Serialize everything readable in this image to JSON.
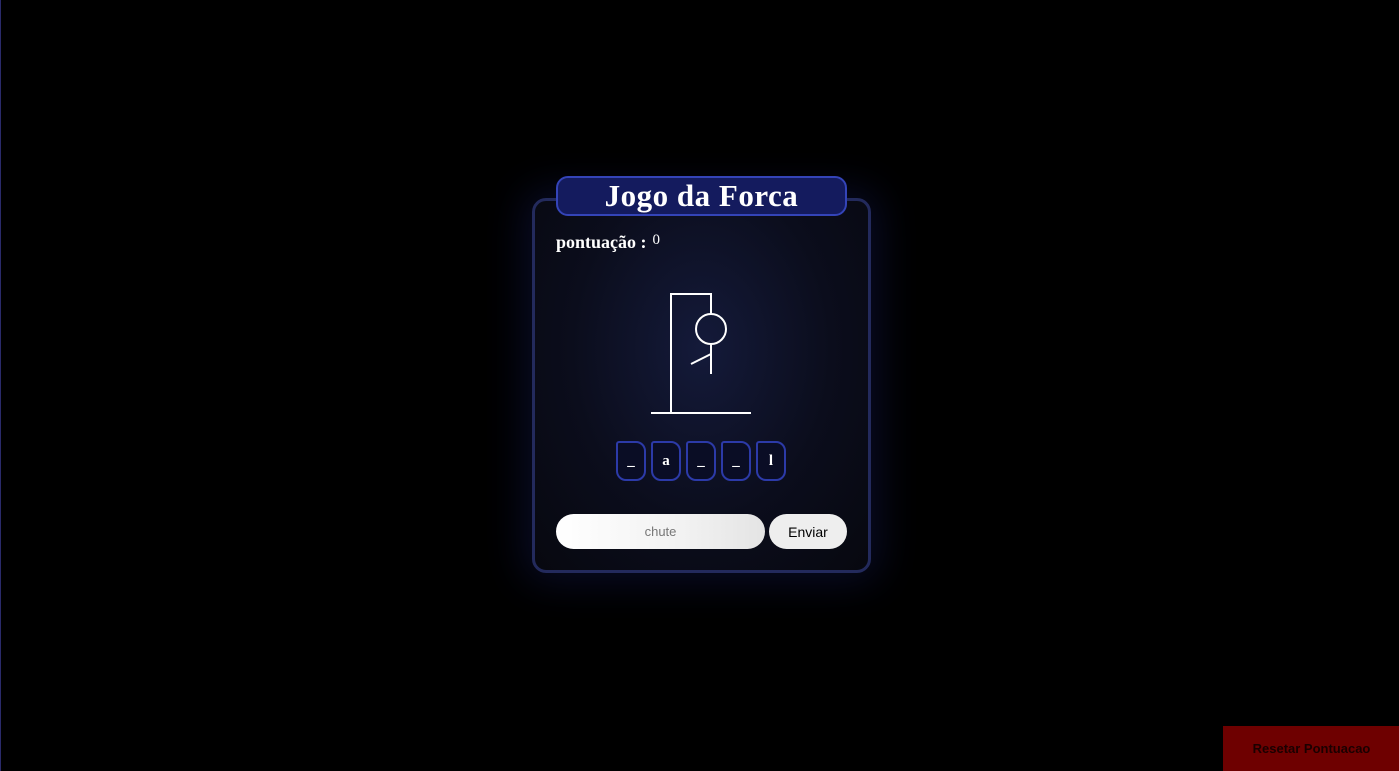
{
  "game": {
    "title": "Jogo da Forca",
    "score_label": "pontuação :",
    "score_value": "0",
    "word_slots": [
      "_",
      "a",
      "_",
      "_",
      "l"
    ],
    "guess_placeholder": "chute",
    "send_label": "Enviar",
    "reset_label": "Resetar Pontuacao",
    "hangman_parts_shown": [
      "head",
      "body",
      "left-arm"
    ]
  },
  "colors": {
    "background": "#000000",
    "card_border": "#232a5c",
    "title_bg": "#141b5e",
    "title_border": "#3444b8",
    "letter_border": "#2c3aa8",
    "reset_bg": "#6e0000"
  }
}
